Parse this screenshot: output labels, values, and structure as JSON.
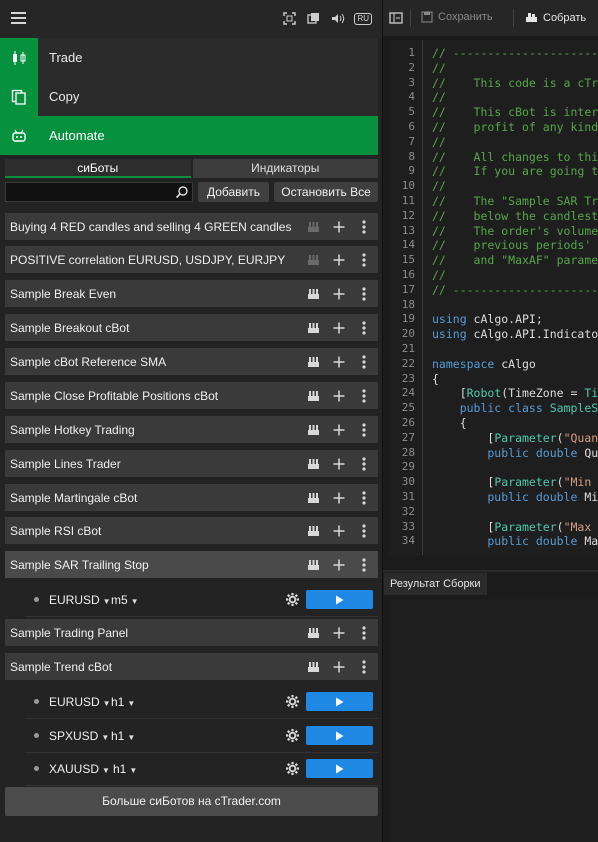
{
  "sidebar_nav": [
    {
      "label": "Trade",
      "icon": "candlestick-icon"
    },
    {
      "label": "Copy",
      "icon": "copy-icon"
    },
    {
      "label": "Automate",
      "icon": "robot-icon"
    }
  ],
  "topbar": {
    "lang_badge": "RU"
  },
  "tabs": [
    {
      "label": "сиБоты",
      "active": true
    },
    {
      "label": "Индикаторы",
      "active": false
    }
  ],
  "search": {
    "value": "",
    "placeholder": ""
  },
  "add_button": "Добавить",
  "stop_all_button": "Остановить Все",
  "bots": [
    {
      "name": "Buying 4 RED candles and selling 4 GREEN candles",
      "build_disabled": true
    },
    {
      "name": "POSITIVE correlation EURUSD, USDJPY, EURJPY",
      "build_disabled": true
    },
    {
      "name": "Sample Break Even"
    },
    {
      "name": "Sample Breakout cBot"
    },
    {
      "name": "Sample cBot Reference SMA"
    },
    {
      "name": "Sample Close Profitable Positions cBot"
    },
    {
      "name": "Sample Hotkey Trading"
    },
    {
      "name": "Sample Lines Trader"
    },
    {
      "name": "Sample Martingale cBot"
    },
    {
      "name": "Sample RSI cBot"
    },
    {
      "name": "Sample SAR Trailing Stop",
      "selected": true
    },
    {
      "name": "Sample Trading Panel"
    },
    {
      "name": "Sample Trend cBot"
    }
  ],
  "instances": [
    {
      "symbol": "EURUSD",
      "timeframe": "m5"
    },
    {
      "symbol": "EURUSD",
      "timeframe": "h1"
    },
    {
      "symbol": "SPXUSD",
      "timeframe": "h1"
    },
    {
      "symbol": "XAUUSD",
      "timeframe": "h1"
    }
  ],
  "more_button": "Больше сиБотов на cTrader.com",
  "editor_toolbar": {
    "save_label": "Сохранить",
    "build_label": "Собрать"
  },
  "code_lines": [
    {
      "n": "1",
      "t": "// ---------------------------------",
      "c": "cm"
    },
    {
      "n": "2",
      "t": "//",
      "c": "cm"
    },
    {
      "n": "3",
      "t": "//    This code is a cTr",
      "c": "cm"
    },
    {
      "n": "4",
      "t": "//",
      "c": "cm"
    },
    {
      "n": "5",
      "t": "//    This cBot is inter",
      "c": "cm"
    },
    {
      "n": "6",
      "t": "//    profit of any kind",
      "c": "cm"
    },
    {
      "n": "7",
      "t": "//",
      "c": "cm"
    },
    {
      "n": "8",
      "t": "//    All changes to thi",
      "c": "cm"
    },
    {
      "n": "9",
      "t": "//    If you are going t",
      "c": "cm"
    },
    {
      "n": "10",
      "t": "//",
      "c": "cm"
    },
    {
      "n": "11",
      "t": "//    The \"Sample SAR Tr",
      "c": "cm"
    },
    {
      "n": "12",
      "t": "//    below the candlest",
      "c": "cm"
    },
    {
      "n": "13",
      "t": "//    The order's volume",
      "c": "cm"
    },
    {
      "n": "14",
      "t": "//    previous periods'",
      "c": "cm"
    },
    {
      "n": "15",
      "t": "//    and \"MaxAF\" parame",
      "c": "cm"
    },
    {
      "n": "16",
      "t": "//",
      "c": "cm"
    },
    {
      "n": "17",
      "t": "// ---------------------------------",
      "c": "cm"
    },
    {
      "n": "18",
      "t": "",
      "c": "tx"
    },
    {
      "n": "19",
      "t": "",
      "c": "tx",
      "parts": [
        [
          "using",
          "kw"
        ],
        [
          " cAlgo.API;",
          "tx"
        ]
      ]
    },
    {
      "n": "20",
      "t": "",
      "c": "tx",
      "parts": [
        [
          "using",
          "kw"
        ],
        [
          " cAlgo.API.Indicato",
          "tx"
        ]
      ]
    },
    {
      "n": "21",
      "t": "",
      "c": "tx"
    },
    {
      "n": "22",
      "t": "",
      "c": "tx",
      "parts": [
        [
          "namespace",
          "kw"
        ],
        [
          " cAlgo",
          "tx"
        ]
      ]
    },
    {
      "n": "23",
      "t": "{",
      "c": "tx"
    },
    {
      "n": "24",
      "t": "",
      "c": "tx",
      "parts": [
        [
          "    [",
          "tx"
        ],
        [
          "Robot",
          "ty"
        ],
        [
          "(TimeZone = ",
          "tx"
        ],
        [
          "Ti",
          "ty"
        ]
      ]
    },
    {
      "n": "25",
      "t": "",
      "c": "tx",
      "parts": [
        [
          "    public class",
          "kw"
        ],
        [
          " SampleS",
          "ty"
        ]
      ]
    },
    {
      "n": "26",
      "t": "    {",
      "c": "tx"
    },
    {
      "n": "27",
      "t": "",
      "c": "tx",
      "parts": [
        [
          "        [",
          "tx"
        ],
        [
          "Parameter",
          "ty"
        ],
        [
          "(",
          "tx"
        ],
        [
          "\"Quan",
          "st"
        ]
      ]
    },
    {
      "n": "28",
      "t": "",
      "c": "tx",
      "parts": [
        [
          "        public double",
          "kw"
        ],
        [
          " Qu",
          "tx"
        ]
      ]
    },
    {
      "n": "29",
      "t": "",
      "c": "tx"
    },
    {
      "n": "30",
      "t": "",
      "c": "tx",
      "parts": [
        [
          "        [",
          "tx"
        ],
        [
          "Parameter",
          "ty"
        ],
        [
          "(",
          "tx"
        ],
        [
          "\"Min",
          "st"
        ]
      ]
    },
    {
      "n": "31",
      "t": "",
      "c": "tx",
      "parts": [
        [
          "        public double",
          "kw"
        ],
        [
          " Mi",
          "tx"
        ]
      ]
    },
    {
      "n": "32",
      "t": "",
      "c": "tx"
    },
    {
      "n": "33",
      "t": "",
      "c": "tx",
      "parts": [
        [
          "        [",
          "tx"
        ],
        [
          "Parameter",
          "ty"
        ],
        [
          "(",
          "tx"
        ],
        [
          "\"Max",
          "st"
        ]
      ]
    },
    {
      "n": "34",
      "t": "",
      "c": "tx",
      "parts": [
        [
          "        public double",
          "kw"
        ],
        [
          " Ma",
          "tx"
        ]
      ]
    }
  ],
  "build_result_tab": "Результат Сборки",
  "colors": {
    "accent_green": "#06913e",
    "play_blue": "#1e88e5"
  }
}
